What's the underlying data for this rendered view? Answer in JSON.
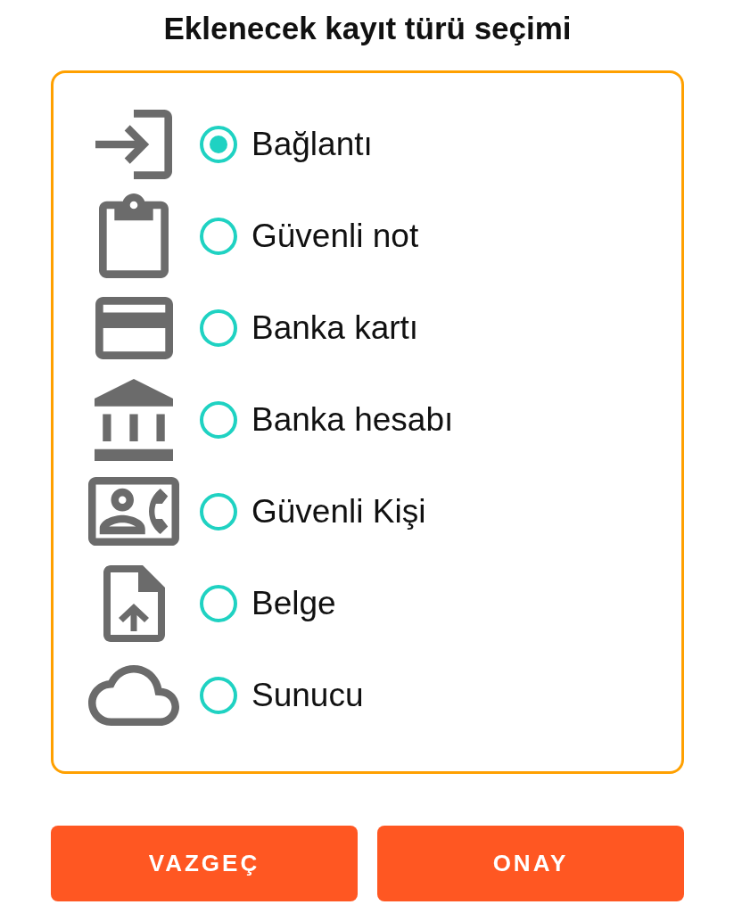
{
  "title": "Eklenecek kayıt türü seçimi",
  "options": [
    {
      "label": "Bağlantı",
      "kind": "login",
      "selected": true
    },
    {
      "label": "Güvenli not",
      "kind": "clipboard",
      "selected": false
    },
    {
      "label": "Banka kartı",
      "kind": "card",
      "selected": false
    },
    {
      "label": "Banka hesabı",
      "kind": "bank",
      "selected": false
    },
    {
      "label": "Güvenli Kişi",
      "kind": "contact",
      "selected": false
    },
    {
      "label": "Belge",
      "kind": "document",
      "selected": false
    },
    {
      "label": "Sunucu",
      "kind": "cloud",
      "selected": false
    }
  ],
  "buttons": [
    "VAZGEÇ",
    "ONAY"
  ]
}
